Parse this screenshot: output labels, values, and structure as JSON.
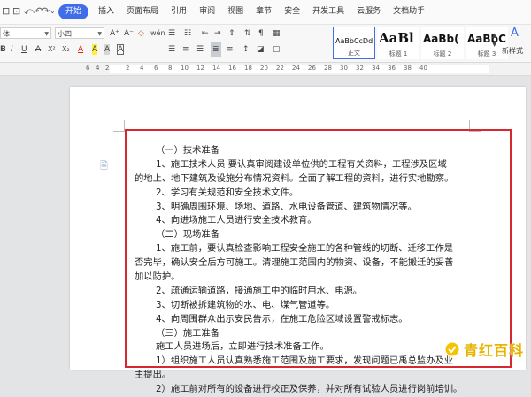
{
  "menubar": {
    "quick_access": [
      "⊟",
      "⊡",
      "⤺",
      "↶",
      "↷",
      "⌄"
    ],
    "tabs": [
      "开始",
      "插入",
      "页面布局",
      "引用",
      "审阅",
      "视图",
      "章节",
      "安全",
      "开发工具",
      "云服务",
      "文档助手"
    ],
    "active_tab": "开始",
    "accent_color": "#3f6ee8"
  },
  "ribbon": {
    "font_name": "体",
    "font_size": "小四",
    "grow_font": "A⁺",
    "shrink_font": "A⁻",
    "clear_format": "◇",
    "text_effect": "wén",
    "bold": "B",
    "italic": "I",
    "underline": "U",
    "strike": "A",
    "superscript": "X²",
    "subscript": "X₂",
    "font_color": "A",
    "highlight": "A",
    "char_shade": "A",
    "char_border": "A",
    "styles": [
      {
        "sample": "AaBbCcDd",
        "name": "正文"
      },
      {
        "sample": "AaBl",
        "name": "标题 1"
      },
      {
        "sample": "AaBb(",
        "name": "标题 2"
      },
      {
        "sample": "AaBbC",
        "name": "标题 3"
      }
    ],
    "new_style_label": "新样式"
  },
  "ruler": {
    "numbers": [
      "6",
      "4",
      "2",
      "2",
      "4",
      "6",
      "8",
      "10",
      "12",
      "14",
      "16",
      "18",
      "20",
      "22",
      "24",
      "26",
      "28",
      "30",
      "32",
      "34",
      "36",
      "38",
      "40"
    ]
  },
  "document": {
    "lines": [
      {
        "text": "（一）技术准备",
        "indent": true
      },
      {
        "text": "1、施工技术人员",
        "after_caret": "要认真审阅建设单位供的工程有关资料，工程涉及区域",
        "indent": true
      },
      {
        "text": "的地上、地下建筑及设施分布情况资料。全面了解工程的资料，进行实地勘察。",
        "indent": false
      },
      {
        "text": "2、学习有关规范和安全技术文件。",
        "indent": true
      },
      {
        "text": "3、明确周围环境、场地、道路、水电设备管道、建筑物情况等。",
        "indent": true
      },
      {
        "text": "4、向进场施工人员进行安全技术教育。",
        "indent": true
      },
      {
        "text": "（二）现场准备",
        "indent": true
      },
      {
        "text": "1、施工前，要认真检查影响工程安全施工的各种管线的切断、迁移工作是",
        "indent": true
      },
      {
        "text": "否完毕，确认安全后方可施工。清理施工范围内的物资、设备，不能搬迁的妥善",
        "indent": false
      },
      {
        "text": "加以防护。",
        "indent": false
      },
      {
        "text": "2、疏通运输道路，接通施工中的临时用水、电源。",
        "indent": true
      },
      {
        "text": "3、切断被拆建筑物的水、电、煤气管道等。",
        "indent": true
      },
      {
        "text": "4、向周围群众出示安民告示，在施工危险区域设置警戒标志。",
        "indent": true
      },
      {
        "text": "（三）施工准备",
        "indent": true
      },
      {
        "text": "施工人员进场后，立即进行技术准备工作。",
        "indent": true
      },
      {
        "text": "1）组织施工人员认真熟悉施工范围及施工要求，发现问题已禹总监办及业",
        "indent": true
      },
      {
        "text": "主提出。",
        "indent": false
      },
      {
        "text": "2）施工前对所有的设备进行校正及保养，并对所有试验人员进行岗前培训。",
        "indent": true
      }
    ],
    "highlight_border_color": "#d8282f"
  },
  "watermark": {
    "text": "青红百科",
    "color": "#e8b400"
  }
}
